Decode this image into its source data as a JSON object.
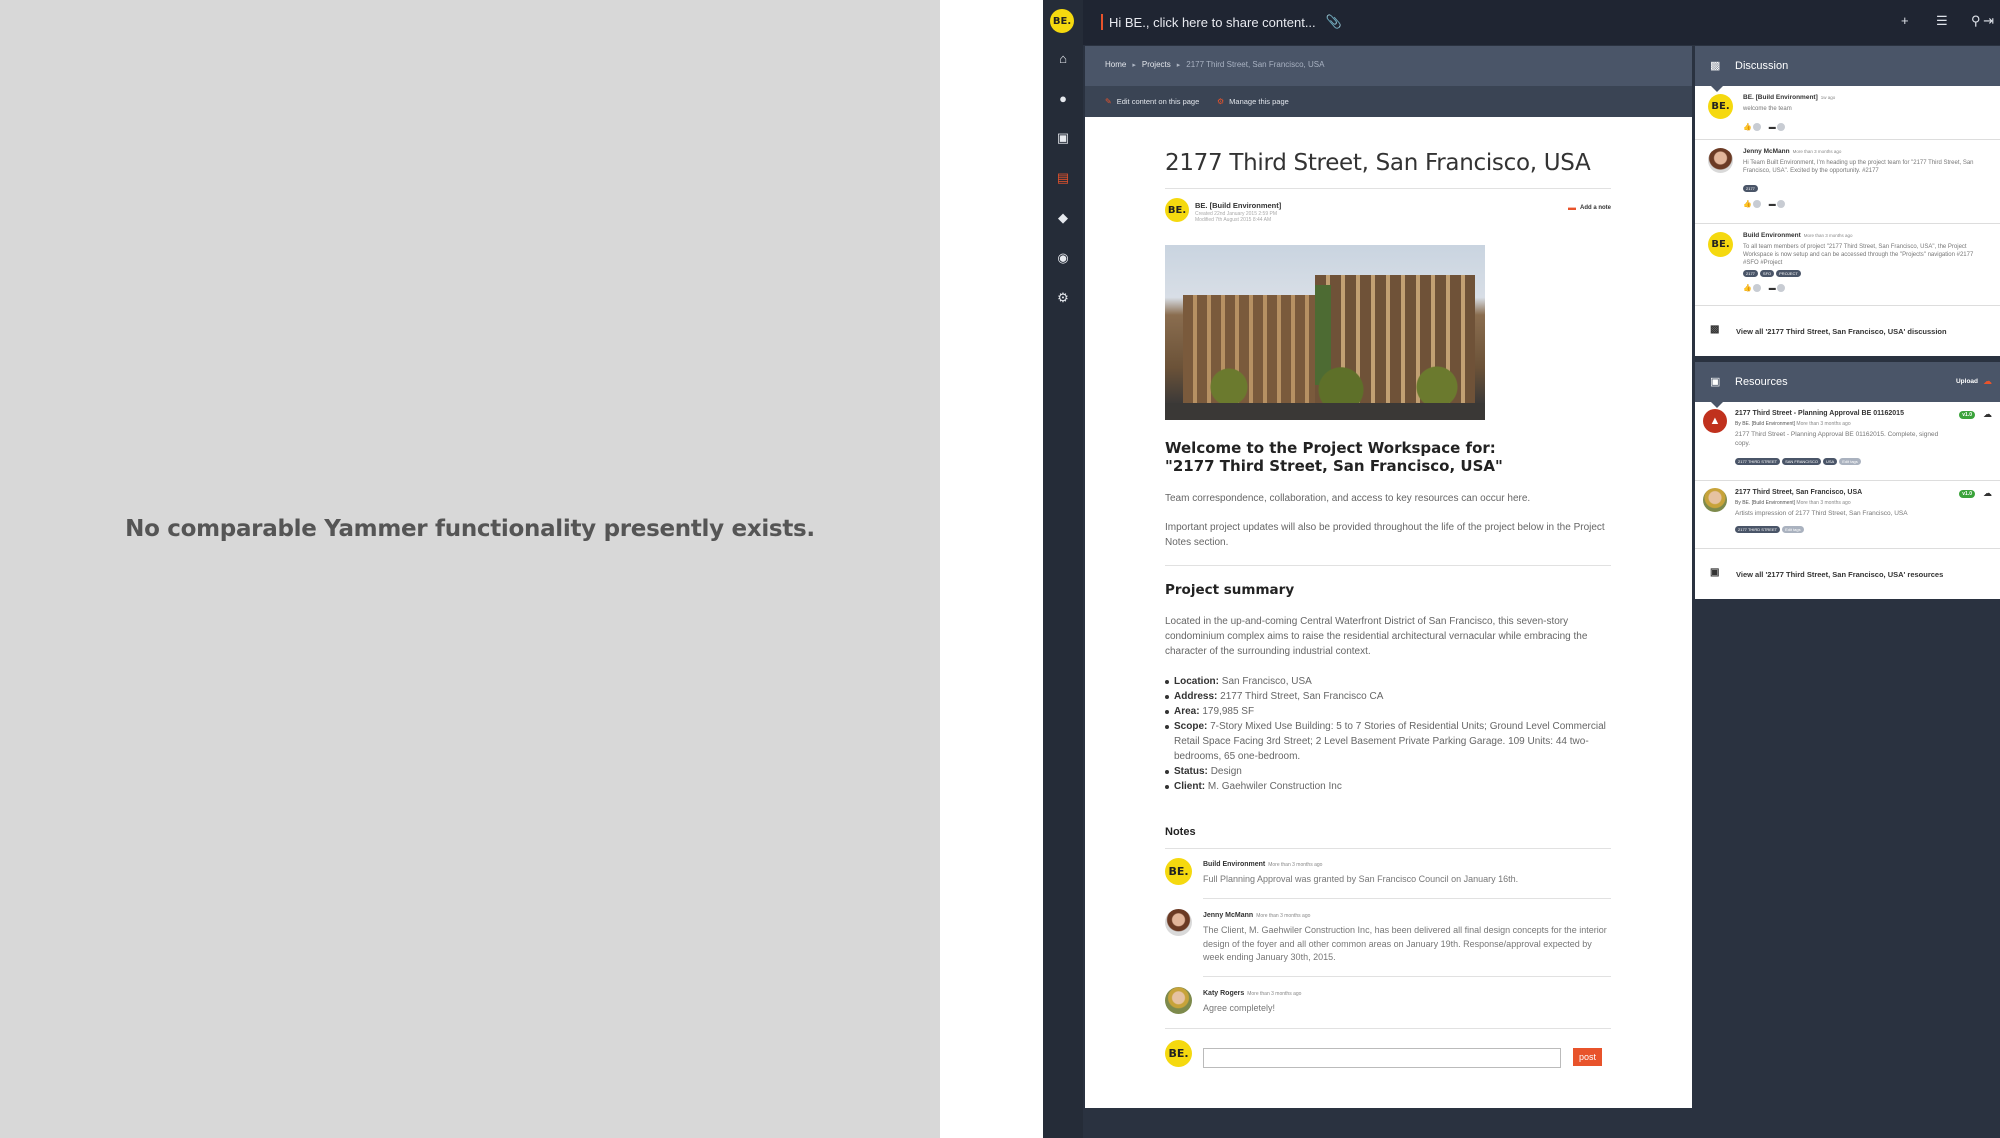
{
  "left_panel": {
    "message": "No comparable Yammer functionality presently exists."
  },
  "app": {
    "logo": "BE.",
    "share_prompt": "Hi BE., click here to share content...",
    "rail_icons": [
      "home-icon",
      "user-icon",
      "briefcase-icon",
      "document-icon",
      "tags-icon",
      "people-icon",
      "gear-icon"
    ],
    "topbar_icons": [
      "plus-icon",
      "list-icon",
      "search-icon",
      "sign-out-icon"
    ],
    "accent": "#e8532b",
    "logo_color": "#f5d90f"
  },
  "breadcrumbs": [
    "Home",
    "Projects",
    "2177 Third Street, San Francisco, USA"
  ],
  "editbar": {
    "edit_label": "Edit content on this page",
    "manage_label": "Manage this page"
  },
  "page": {
    "title": "2177 Third Street, San Francisco, USA",
    "author": "BE. [Build Environment]",
    "created": "Created 22nd January 2015 2:59 PM",
    "modified": "Modified 7th August 2015 8:44 AM",
    "add_note": "Add a note",
    "welcome_line1": "Welcome to the Project Workspace for:",
    "welcome_line2": "\"2177 Third Street, San Francisco, USA\"",
    "intro1": "Team correspondence, collaboration, and access to key resources can occur here.",
    "intro2": "Important project updates will also be provided throughout the life of the project below in the Project Notes section.",
    "summary_heading": "Project summary",
    "summary": "Located in the up-and-coming Central Waterfront District of San Francisco, this seven-story condominium complex aims to raise the residential architectural vernacular while embracing the character of the surrounding industrial context.",
    "facts": [
      {
        "label": "Location:",
        "value": "San Francisco, USA"
      },
      {
        "label": "Address:",
        "value": "2177 Third Street, San Francisco CA"
      },
      {
        "label": "Area:",
        "value": "179,985 SF"
      },
      {
        "label": "Scope:",
        "value": "7-Story Mixed Use Building: 5 to 7 Stories of Residential Units; Ground Level Commercial Retail Space Facing 3rd Street; 2 Level Basement Private Parking Garage. 109 Units: 44 two-bedrooms, 65 one-bedroom."
      },
      {
        "label": "Status:",
        "value": "Design"
      },
      {
        "label": "Client:",
        "value": "M. Gaehwiler Construction Inc"
      }
    ],
    "notes_heading": "Notes",
    "notes": [
      {
        "who": "Build Environment",
        "when": "More than 3 months ago",
        "text": "Full Planning Approval was granted by San Francisco Council on January 16th."
      },
      {
        "who": "Jenny McMann",
        "when": "More than 3 months ago",
        "text": "The Client, M. Gaehwiler Construction Inc, has been delivered all final design concepts for the interior design of the foyer and all other common areas on January 19th. Response/approval expected by week ending January 30th, 2015."
      },
      {
        "who": "Katy Rogers",
        "when": "More than 3 months ago",
        "text": "Agree completely!"
      }
    ],
    "post_label": "post"
  },
  "discussion": {
    "heading": "Discussion",
    "items": [
      {
        "who": "BE. [Build Environment]",
        "when": "1w ago",
        "text": "welcome the team",
        "tags": []
      },
      {
        "who": "Jenny McMann",
        "when": "More than 3 months ago",
        "text": "Hi Team Built Environment, I'm heading up the project team for \"2177 Third Street, San Francisco, USA\". Excited by the opportunity. #2177",
        "tags": [
          "2177"
        ]
      },
      {
        "who": "Build Environment",
        "when": "More than 3 months ago",
        "text": "To all team members of project \"2177 Third Street, San Francisco, USA\", the Project Workspace is now setup and can be accessed through the \"Projects\" navigation #2177 #SFO #Project",
        "tags": [
          "2177",
          "SFO",
          "PROJECT"
        ]
      }
    ],
    "view_all": "View all '2177 Third Street, San Francisco, USA' discussion"
  },
  "resources": {
    "heading": "Resources",
    "upload_label": "Upload",
    "items": [
      {
        "title": "2177 Third Street - Planning Approval BE 01162015",
        "by": "By BE. [Build Environment]",
        "when": "More than 3 months ago",
        "desc": "2177 Third Street - Planning Approval BE 01162015. Complete, signed copy.",
        "version": "v1.0",
        "tags": [
          "2177 THIRD STREET",
          "SAN FRANCISCO",
          "USA"
        ],
        "more": "Edit tags"
      },
      {
        "title": "2177 Third Street, San Francisco, USA",
        "by": "By BE. [Build Environment]",
        "when": "More than 3 months ago",
        "desc": "Artists impression of 2177 Third Street, San Francisco, USA",
        "version": "v1.0",
        "tags": [
          "2177 THIRD STREET"
        ],
        "more": "Edit tags"
      }
    ],
    "view_all": "View all '2177 Third Street, San Francisco, USA' resources"
  }
}
